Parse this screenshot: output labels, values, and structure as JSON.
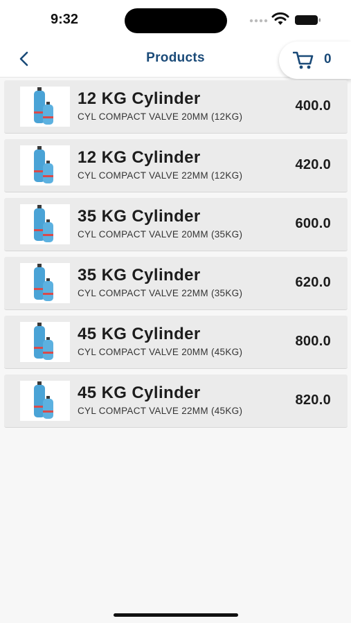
{
  "status_bar": {
    "time": "9:32"
  },
  "header": {
    "title": "Products",
    "cart_count": "0"
  },
  "products": [
    {
      "name": "12 KG Cylinder",
      "description": "CYL COMPACT VALVE 20MM (12KG)",
      "price": "400.0"
    },
    {
      "name": "12 KG Cylinder",
      "description": "CYL COMPACT VALVE 22MM (12KG)",
      "price": "420.0"
    },
    {
      "name": "35 KG Cylinder",
      "description": "CYL COMPACT VALVE 20MM (35KG)",
      "price": "600.0"
    },
    {
      "name": "35 KG Cylinder",
      "description": "CYL COMPACT VALVE 22MM (35KG)",
      "price": "620.0"
    },
    {
      "name": "45 KG Cylinder",
      "description": "CYL COMPACT VALVE 20MM (45KG)",
      "price": "800.0"
    },
    {
      "name": "45 KG Cylinder",
      "description": "CYL COMPACT VALVE 22MM (45KG)",
      "price": "820.0"
    }
  ],
  "colors": {
    "accent": "#1a4a78",
    "cylinder": "#4aa3d6",
    "band": "#d94a4a"
  },
  "icons": {
    "back": "chevron-left-icon",
    "cart": "shopping-cart-icon",
    "product": "gas-cylinder-icon"
  }
}
